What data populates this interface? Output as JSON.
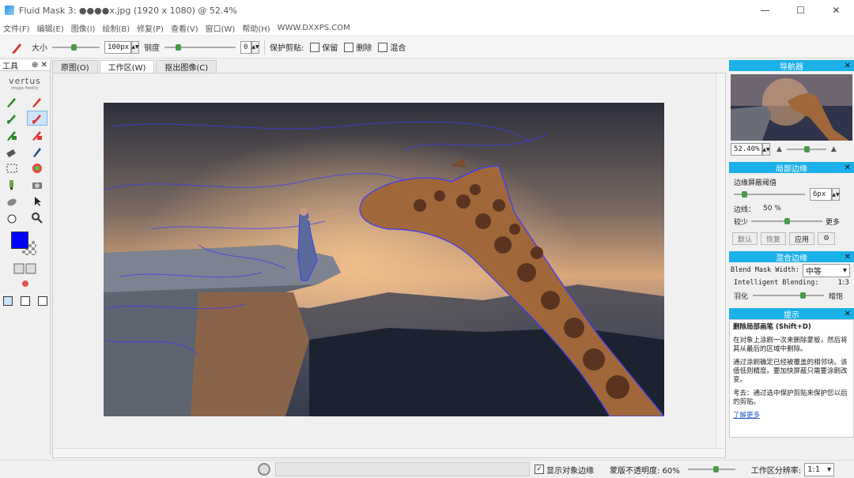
{
  "window": {
    "title": "Fluid Mask 3: ●●●●x.jpg (1920 x 1080) @ 52.4%",
    "min": "—",
    "max": "☐",
    "close": "✕"
  },
  "menu": [
    "文件(F)",
    "编辑(E)",
    "图像(I)",
    "绘制(B)",
    "修复(P)",
    "查看(V)",
    "窗口(W)",
    "帮助(H)",
    "WWW.DXXPS.COM"
  ],
  "toolbar": {
    "size_label": "大小",
    "size_value": "100px",
    "hardness_label": "钢度",
    "hardness_value": "0",
    "protect_label": "保护剪贴:",
    "keep_label": "保留",
    "delete_label": "删除",
    "mix_label": "混合"
  },
  "left": {
    "title": "工具",
    "pin": "⊕",
    "close": "✕",
    "brand": "vertus",
    "brand_sub": "image fidelity"
  },
  "tabs": [
    "原图(O)",
    "工作区(W)",
    "抠出图像(C)"
  ],
  "navigator": {
    "title": "导航器",
    "zoom": "52.40%"
  },
  "local_edge": {
    "title": "局部边缘",
    "threshold_label": "边缘屏蔽阈值",
    "threshold_value": "6px",
    "edge_label": "边线：",
    "edge_value": "50 %",
    "less": "较少",
    "more": "更多",
    "buttons": [
      "默认",
      "恢复",
      "应用"
    ]
  },
  "blend": {
    "title": "混合边缘",
    "width_label": "Blend Mask Width:",
    "width_value": "中等",
    "intel_label": "Intelligent Blending:",
    "intel_value": "1:3",
    "soft": "羽化",
    "dark": "暗饱"
  },
  "tips": {
    "title": "提示",
    "heading": "删除局部画笔 (Shift+D)",
    "p1": "在对象上涂刷一次来删除蒙板，然后将其从最后的区域中删除。",
    "p2": "通过涂刷确定已经被覆盖的相邻块。该值低则精度。要加快屏蔽只需要涂刷改变。",
    "p3": "考去：通过选中保护剪贴来保护您以后的剪贴。",
    "more": "了解更多"
  },
  "status": {
    "show_edges": "显示对象边缘",
    "opacity": "蒙版不透明度: 60%",
    "resolution_label": "工作区分辨率:",
    "resolution_value": "1:1"
  }
}
